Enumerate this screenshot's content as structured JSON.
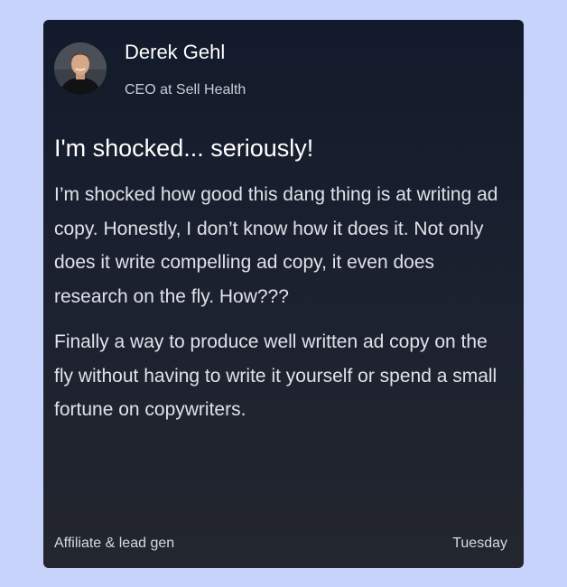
{
  "testimonial": {
    "author_name": "Derek Gehl",
    "author_role": "CEO at Sell Health",
    "headline": "I'm shocked... seriously!",
    "paragraphs": [
      "I’m shocked how good this dang thing is at writing ad copy. Honestly, I don’t know how it does it. Not only does it write compelling ad copy, it even does research on the fly. How???",
      "Finally a way to produce well written ad copy on the fly without having to write it yourself or spend a small fortune on copywriters."
    ],
    "category": "Affiliate & lead gen",
    "date": "Tuesday"
  },
  "colors": {
    "page_background": "#c8d3fc",
    "card_background_top": "#121a2b",
    "card_background_bottom": "#23262e"
  }
}
